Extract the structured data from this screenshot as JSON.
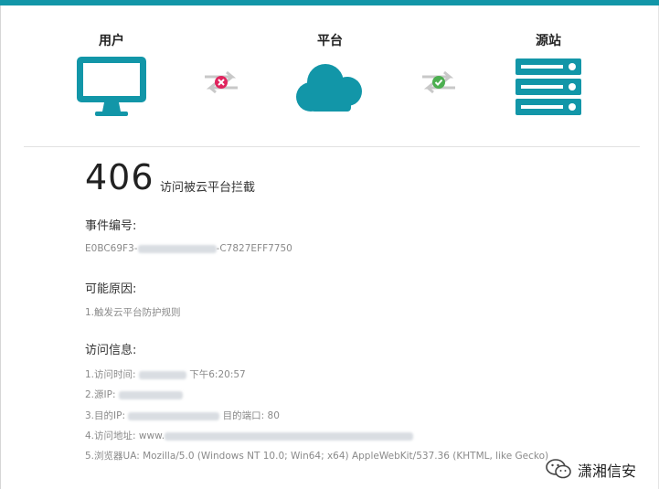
{
  "nodes": {
    "user": "用户",
    "platform": "平台",
    "source": "源站"
  },
  "status": {
    "code": "406",
    "message": "访问被云平台拦截"
  },
  "event": {
    "title": "事件编号:",
    "id_prefix": "E0BC69F3-",
    "id_suffix": "-C7827EFF7750"
  },
  "reasons": {
    "title": "可能原因:",
    "items": [
      "1.触发云平台防护规则"
    ]
  },
  "access": {
    "title": "访问信息:",
    "time_label": "1.访问时间:",
    "time_value": "下午6:20:57",
    "src_ip_label": "2.源IP:",
    "dst_ip_label": "3.目的IP:",
    "dst_port_label": "目的端口: 80",
    "address_label": "4.访问地址: www.",
    "ua": "5.浏览器UA: Mozilla/5.0 (Windows NT 10.0; Win64; x64) AppleWebKit/537.36 (KHTML, like Gecko) "
  },
  "watermark": {
    "text": "潇湘信安"
  },
  "colors": {
    "accent": "#1296a8",
    "error": "#e0245e",
    "ok": "#4caf50"
  },
  "icons": {
    "user": "monitor-icon",
    "platform": "cloud-icon",
    "source": "server-icon",
    "blocked": "arrows-blocked-icon",
    "allowed": "arrows-ok-icon"
  }
}
